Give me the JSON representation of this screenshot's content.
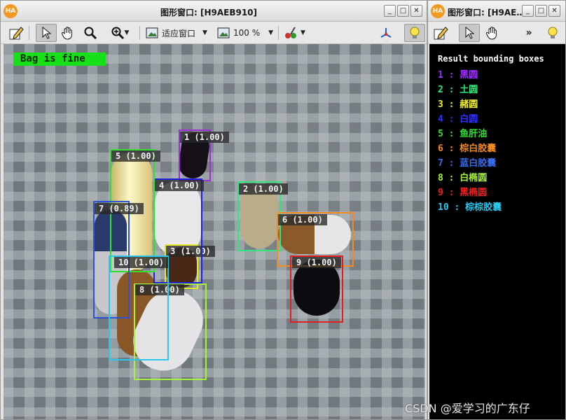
{
  "main_window": {
    "logo": "HA",
    "title": "图形窗口: [H9AEB910]",
    "buttons": {
      "minimize": "_",
      "maximize": "□",
      "close": "✕"
    },
    "toolbar": {
      "fit_label": "适应窗口",
      "zoom_label": "100 %"
    },
    "canvas": {
      "status": "Bag is fine",
      "boxes": [
        {
          "label": "1 (1.00)",
          "color": "#9b30d9"
        },
        {
          "label": "2 (1.00)",
          "color": "#2ee87a"
        },
        {
          "label": "3 (1.00)",
          "color": "#e8e82a"
        },
        {
          "label": "4 (1.00)",
          "color": "#2020e0"
        },
        {
          "label": "5 (1.00)",
          "color": "#2fe02f"
        },
        {
          "label": "6 (1.00)",
          "color": "#f5891f"
        },
        {
          "label": "7 (0.89)",
          "color": "#2a52d6"
        },
        {
          "label": "8 (1.00)",
          "color": "#a6f23a"
        },
        {
          "label": "9 (1.00)",
          "color": "#e02020"
        },
        {
          "label": "10 (1.00)",
          "color": "#28c8ee"
        }
      ]
    }
  },
  "side_window": {
    "logo": "HA",
    "title": "图形窗口: [H9AE…",
    "buttons": {
      "minimize": "_",
      "maximize": "□",
      "close": "✕"
    },
    "toolbar": {
      "more": "»"
    },
    "heading": "Result bounding boxes",
    "results": [
      {
        "text": "1 : 黑圆",
        "color": "#a030ff"
      },
      {
        "text": "2 : 土圆",
        "color": "#2ee87a"
      },
      {
        "text": "3 : 赭圆",
        "color": "#f0f02a"
      },
      {
        "text": "4 : 白圆",
        "color": "#3030ff"
      },
      {
        "text": "5 : 鱼肝油",
        "color": "#2fe02f"
      },
      {
        "text": "6 : 棕白胶囊",
        "color": "#f5891f"
      },
      {
        "text": "7 : 蓝白胶囊",
        "color": "#3a6cf0"
      },
      {
        "text": "8 : 白椭圆",
        "color": "#a6f23a"
      },
      {
        "text": "9 : 黑椭圆",
        "color": "#f02020"
      },
      {
        "text": "10 : 棕棕胶囊",
        "color": "#28c8ee"
      }
    ]
  },
  "watermark": "CSDN @爱学习的广东仔"
}
